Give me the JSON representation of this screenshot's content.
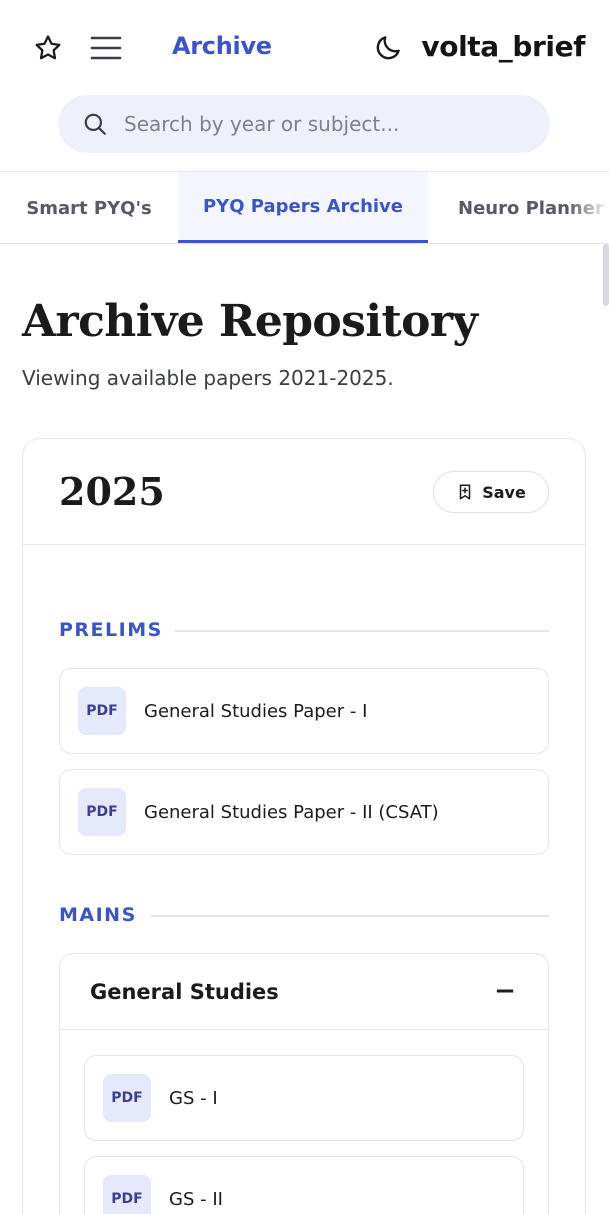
{
  "header": {
    "title": "Archive",
    "brand": "volta_brief",
    "icons": {
      "star": "star-icon",
      "menu": "menu-icon",
      "theme": "moon-icon",
      "search": "search-icon"
    }
  },
  "search": {
    "placeholder": "Search by year or subject...",
    "value": ""
  },
  "tabs": [
    {
      "label": "Smart PYQ's",
      "active": false
    },
    {
      "label": "PYQ Papers Archive",
      "active": true
    },
    {
      "label": "Neuro Planner",
      "active": false
    }
  ],
  "page": {
    "title": "Archive Repository",
    "subtitle": "Viewing available papers 2021-2025."
  },
  "year_card": {
    "year": "2025",
    "save_label": "Save",
    "sections": {
      "prelims": {
        "label": "PRELIMS",
        "papers": [
          {
            "badge": "PDF",
            "name": "General Studies Paper - I"
          },
          {
            "badge": "PDF",
            "name": "General Studies Paper - II (CSAT)"
          }
        ]
      },
      "mains": {
        "label": "MAINS",
        "group": {
          "title": "General Studies",
          "toggle": "−",
          "papers": [
            {
              "badge": "PDF",
              "name": "GS - I"
            },
            {
              "badge": "PDF",
              "name": "GS - II"
            }
          ]
        }
      }
    }
  },
  "colors": {
    "accent": "#3b55c8",
    "badge_bg": "#e6e8fb",
    "search_bg": "#eef1f8"
  }
}
